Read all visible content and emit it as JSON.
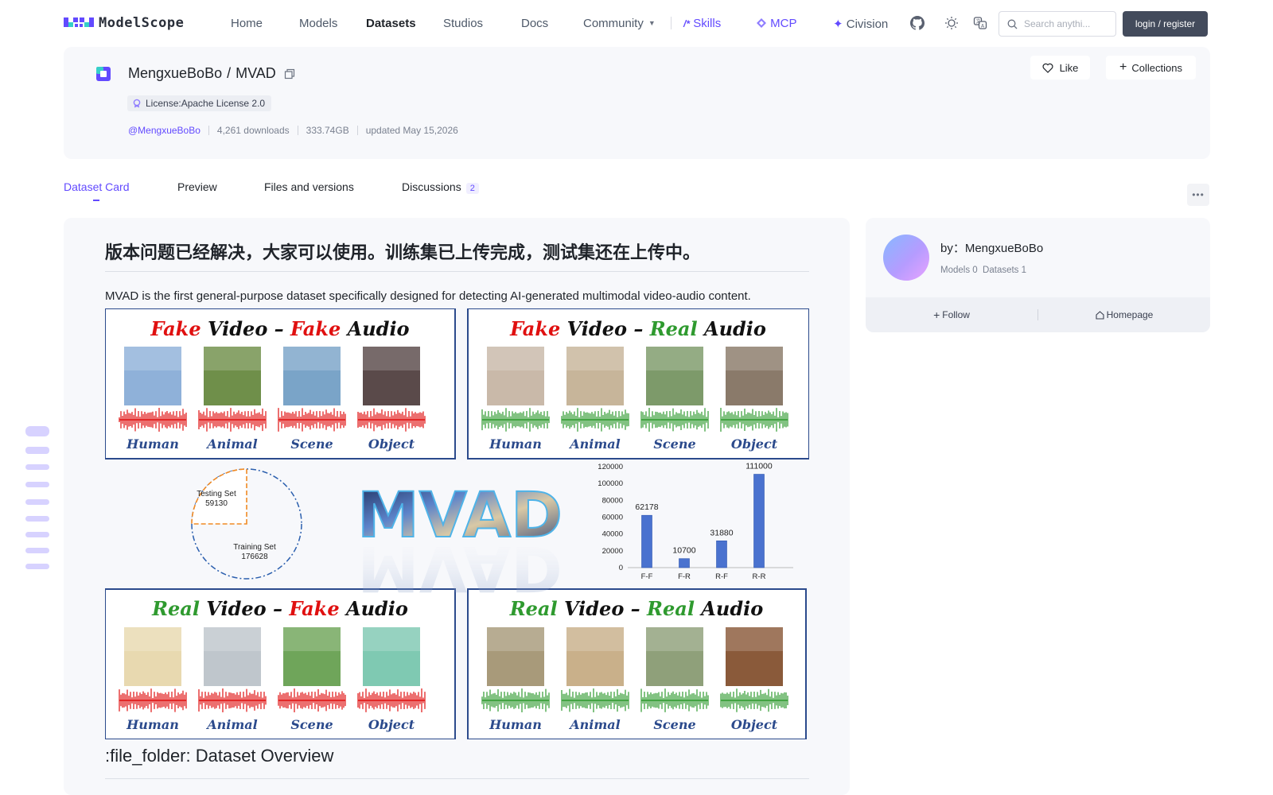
{
  "nav": {
    "logo_text": "ModelScope",
    "items": [
      "Home",
      "Models",
      "Datasets",
      "Studios",
      "Docs"
    ],
    "community": "Community",
    "skills": "Skills",
    "mcp": "MCP",
    "civision": "Civision",
    "search_placeholder": "Search anythi...",
    "login": "login / register"
  },
  "dataset": {
    "owner": "MengxueBoBo",
    "slash": "/",
    "name": "MVAD",
    "license": "License:Apache License 2.0",
    "owner_handle": "@MengxueBoBo",
    "downloads": "4,261 downloads",
    "size": "333.74GB",
    "updated": "updated May 15,2026",
    "like": "Like",
    "collections": "Collections"
  },
  "tabs": {
    "card": "Dataset Card",
    "preview": "Preview",
    "files": "Files and versions",
    "discussions": "Discussions",
    "discussions_count": "2"
  },
  "content": {
    "heading": "版本问题已经解决，大家可以使用。训练集已上传完成，测试集还在上传中。",
    "intro": "MVAD is the first general-purpose dataset specifically designed for detecting AI-generated multimodal video-audio content.",
    "overview_heading": ":file_folder: Dataset Overview",
    "figure": {
      "panels": [
        {
          "w1": "Fake",
          "w2": " Video – ",
          "w3": "Fake",
          "w4": " Audio"
        },
        {
          "w1": "Fake",
          "w2": " Video – ",
          "w3": "Real",
          "w4": " Audio"
        },
        {
          "w1": "Real",
          "w2": " Video – ",
          "w3": "Fake",
          "w4": " Audio"
        },
        {
          "w1": "Real",
          "w2": " Video – ",
          "w3": "Real",
          "w4": " Audio"
        }
      ],
      "categories": [
        "Human",
        "Animal",
        "Scene",
        "Object"
      ],
      "logo": "MVAD",
      "pie": {
        "testing_label": "Testing Set",
        "testing_value": "59130",
        "training_label": "Training Set",
        "training_value": "176628"
      }
    }
  },
  "chart_data": {
    "type": "bar",
    "categories": [
      "F-F",
      "F-R",
      "R-F",
      "R-R"
    ],
    "values": [
      62178,
      10700,
      31880,
      111000
    ],
    "value_labels": [
      "62178",
      "10700",
      "31880",
      "111000"
    ],
    "ylim": [
      0,
      120000
    ],
    "yticks": [
      "0",
      "20000",
      "40000",
      "60000",
      "80000",
      "100000",
      "120000"
    ],
    "title": "",
    "xlabel": "",
    "ylabel": "",
    "bar_color": "#4a72cf"
  },
  "author": {
    "by": "by：MengxueBoBo",
    "stats": "Models 0  Datasets 1",
    "follow": "Follow",
    "homepage": "Homepage"
  },
  "colors": {
    "accent": "#624aff",
    "fake": "#e01010",
    "real": "#2f9a2f",
    "panel_border": "#2b4a8c"
  }
}
